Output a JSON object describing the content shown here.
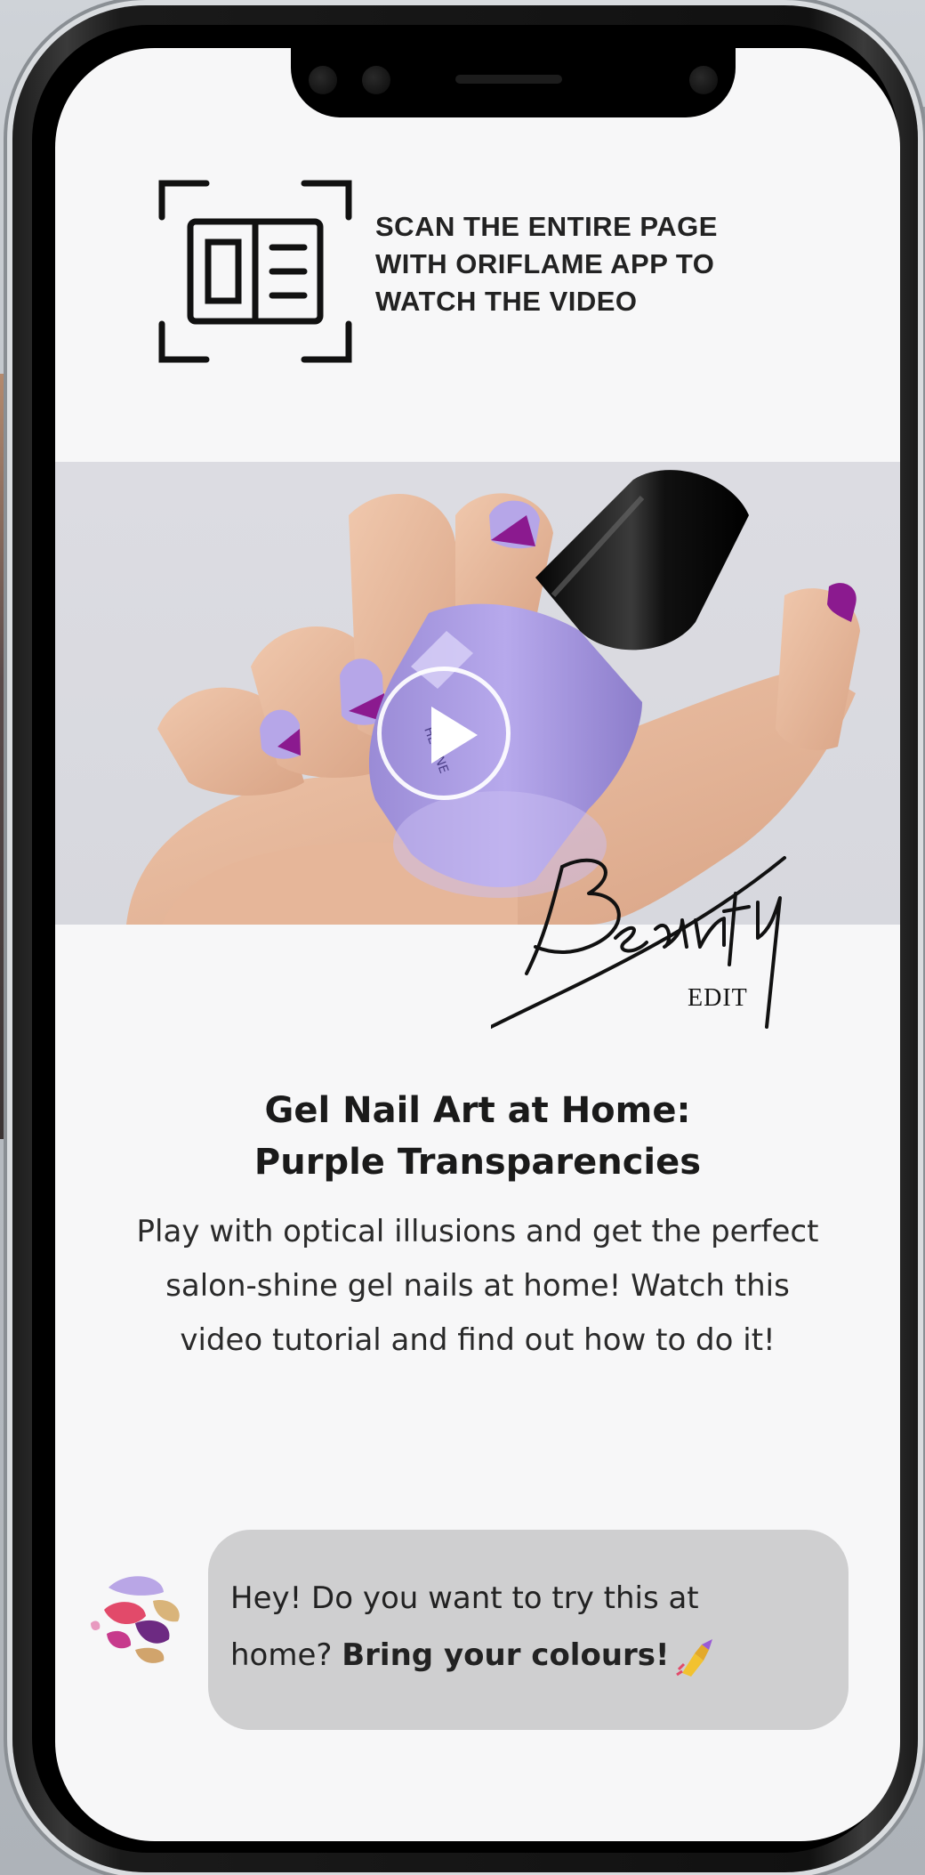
{
  "scan_banner": {
    "lines": [
      "SCAN THE ENTIRE PAGE",
      "WITH ORIFLAME APP TO",
      "WATCH THE VIDEO"
    ],
    "icon": "scan-page-icon"
  },
  "video": {
    "play_icon": "play-icon",
    "logo_text": "Beauty",
    "logo_subtext": "EDIT"
  },
  "article": {
    "title_lines": [
      "Gel Nail Art at Home:",
      "Purple Transparencies"
    ],
    "description_lines": [
      "Play with optical illusions and get the perfect",
      "salon-shine gel nails at home! Watch this",
      "video tutorial and find out how to do it!"
    ]
  },
  "chat": {
    "line1": "Hey! Do you want to try this at",
    "line2_prefix": "home?",
    "line2_bold": "Bring your colours!",
    "emoji_icon": "nail-polish-icon"
  },
  "colors": {
    "accent_purple": "#8b1a8f",
    "polish_lilac": "#a99be0",
    "bubble_bg": "#cfcfd0"
  }
}
